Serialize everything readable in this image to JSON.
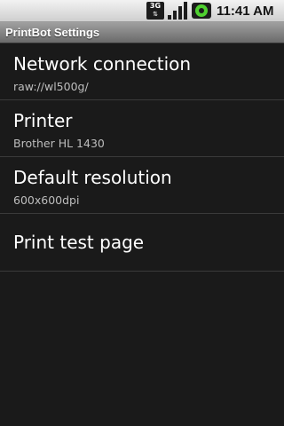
{
  "status_bar": {
    "network_type": "3G",
    "network_arrows": "⇅",
    "signal_icon": "signal-strength-icon",
    "battery_icon": "battery-icon",
    "time": "11:41 AM"
  },
  "title_bar": {
    "title": "PrintBot Settings"
  },
  "settings": [
    {
      "title": "Network connection",
      "summary": "raw://wl500g/"
    },
    {
      "title": "Printer",
      "summary": "Brother HL 1430"
    },
    {
      "title": "Default resolution",
      "summary": "600x600dpi"
    },
    {
      "title": "Print test page"
    }
  ]
}
